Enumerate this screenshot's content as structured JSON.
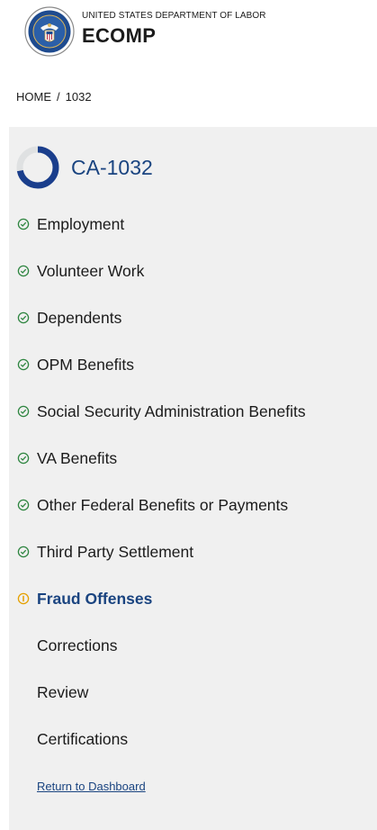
{
  "header": {
    "agency": "UNITED STATES DEPARTMENT OF LABOR",
    "app_name": "ECOMP"
  },
  "breadcrumb": {
    "home": "HOME",
    "separator": "/",
    "current": "1032"
  },
  "form": {
    "title": "CA-1032",
    "progress": 0.72
  },
  "nav": {
    "items": [
      {
        "label": "Employment",
        "status": "complete",
        "icon": "check-circle-icon"
      },
      {
        "label": "Volunteer Work",
        "status": "complete",
        "icon": "check-circle-icon"
      },
      {
        "label": "Dependents",
        "status": "complete",
        "icon": "check-circle-icon"
      },
      {
        "label": "OPM Benefits",
        "status": "complete",
        "icon": "check-circle-icon"
      },
      {
        "label": "Social Security Administration Benefits",
        "status": "complete",
        "icon": "check-circle-icon"
      },
      {
        "label": "VA Benefits",
        "status": "complete",
        "icon": "check-circle-icon"
      },
      {
        "label": "Other Federal Benefits or Payments",
        "status": "complete",
        "icon": "check-circle-icon"
      },
      {
        "label": "Third Party Settlement",
        "status": "complete",
        "icon": "check-circle-icon"
      },
      {
        "label": "Fraud Offenses",
        "status": "in-progress",
        "icon": "warning-circle-icon"
      },
      {
        "label": "Corrections",
        "status": "pending"
      },
      {
        "label": "Review",
        "status": "pending"
      },
      {
        "label": "Certifications",
        "status": "pending"
      }
    ]
  },
  "return_link": "Return to Dashboard",
  "colors": {
    "accent": "#1a4480",
    "progress_track": "#dfe1e2",
    "progress_fill": "#1a3e8c",
    "complete": "#2e8540",
    "warning": "#e5a000",
    "panel_bg": "#f0f0f0"
  }
}
